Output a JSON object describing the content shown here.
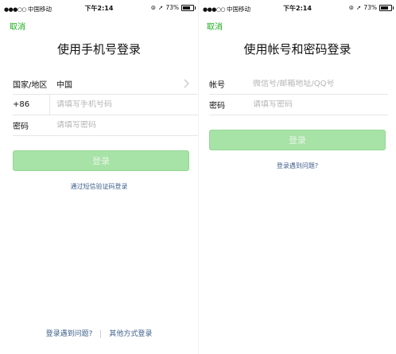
{
  "status_bar": {
    "carrier": "中国移动",
    "time": "下午2:14",
    "battery": "73%",
    "battery_level": 0.73
  },
  "phone_login": {
    "cancel_label": "取消",
    "title": "使用手机号登录",
    "region_label": "国家/地区",
    "region_value": "中国",
    "country_code": "+86",
    "phone_placeholder": "请填写手机号码",
    "password_label": "密码",
    "password_placeholder": "请填写密码",
    "login_label": "登录",
    "sms_login_link": "通过短信验证码登录",
    "trouble_link": "登录遇到问题?",
    "other_methods_link": "其他方式登录"
  },
  "account_login": {
    "cancel_label": "取消",
    "title": "使用帐号和密码登录",
    "account_label": "帐号",
    "account_placeholder": "微信号/邮箱地址/QQ号",
    "password_label": "密码",
    "password_placeholder": "请填写密码",
    "login_label": "登录",
    "trouble_link": "登录遇到问题?"
  },
  "colors": {
    "accent": "#1aad19",
    "button_disabled": "#a7e2a6",
    "link": "#3e5f8a"
  }
}
